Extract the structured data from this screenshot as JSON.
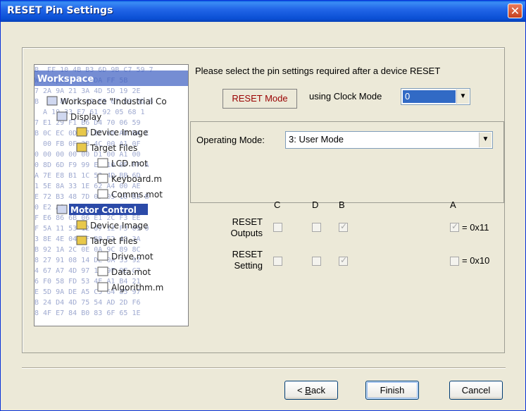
{
  "window": {
    "title": "RESET Pin Settings",
    "close_glyph": "✕"
  },
  "picture": {
    "hex_rows": [
      "B  FF 10 4B B3 6D 9B C7 59 7",
      "Workspace  48 DA FF 5B",
      "7 2A 9A 21 3A 4D 5D 19 2E",
      "B  F1 8F 12 49 E5 67 G9 8D 8",
      "  A 19 33 E7 61 92 05 68 1",
      "7 E1 29 F1 B6 D4 70 06 59",
      "B 0C EC 0D F7 8F 00 AD BA C",
      "  00 FB 0F 3B 4C 00 A1 0F",
      "0 00 00 00 00 D1 00 A1 00",
      "0 8D 6D F9 99 E5 10 0F FF A",
      "A 7E E8 B1 1C 53 4D BB 6D",
      "1 5E 8A 33 1E 62 A4 00 AE",
      "E 72 B3 48 7D 0D 05 18 B2 B",
      "0 E2 A8 2D 75 B5 10 5D 42",
      "F E6 86 6B 06 E1 2C F3 EE",
      "F 5A 11 53 12 07 12 F3 09 0",
      "3 8E 4E 04 EF B8 E2 43 3A",
      "B 92 1A 2C 0E 0A 9C 89 8C",
      "8 27 91 08 14 DE 0A 33 92",
      "4 67 A7 4D 97 10 9F 9E C7",
      "6 F0 58 FD 53 4E A1 B4 21",
      "E 5D 9A DE A5 C5 64 85 97",
      "B 24 D4 4D 75 54 AD 2D F6",
      "8 4F E7 84 B0 83 6F 65 1E"
    ],
    "tree": [
      {
        "label": "Workspace",
        "kind": "header"
      },
      {
        "label": "Workspace \"Industrial Co",
        "kind": "root"
      },
      {
        "label": "Display",
        "kind": "project"
      },
      {
        "label": "Device Image",
        "kind": "folder"
      },
      {
        "label": "Target Files",
        "kind": "folder"
      },
      {
        "label": "LCD.mot",
        "kind": "file"
      },
      {
        "label": "Keyboard.m",
        "kind": "file"
      },
      {
        "label": "Comms.mot",
        "kind": "file"
      },
      {
        "label": "Motor Control",
        "kind": "project-selected"
      },
      {
        "label": "Device Image",
        "kind": "folder"
      },
      {
        "label": "Target Files",
        "kind": "folder"
      },
      {
        "label": "Drive.mot",
        "kind": "file"
      },
      {
        "label": "Data.mot",
        "kind": "file"
      },
      {
        "label": "Algorithm.m",
        "kind": "file"
      }
    ]
  },
  "prompt": "Please select the pin settings required after a device RESET",
  "reset_mode_label": "RESET Mode",
  "clock": {
    "label": "using Clock Mode",
    "value": "0"
  },
  "operating": {
    "label": "Operating Mode:",
    "value": "3: User Mode"
  },
  "pins": {
    "columns": [
      "C",
      "D",
      "B",
      "A"
    ],
    "rows": [
      {
        "label_line1": "RESET",
        "label_line2": "Outputs",
        "checked": [
          false,
          false,
          true,
          true
        ],
        "hex": "= 0x11"
      },
      {
        "label_line1": "RESET",
        "label_line2": "Setting",
        "checked": [
          false,
          false,
          true,
          false
        ],
        "hex": "= 0x10"
      }
    ]
  },
  "buttons": {
    "back_prefix": "< ",
    "back_access": "B",
    "back_rest": "ack",
    "finish": "Finish",
    "cancel": "Cancel"
  },
  "icons": {
    "dropdown": "▼",
    "check": "✓"
  }
}
